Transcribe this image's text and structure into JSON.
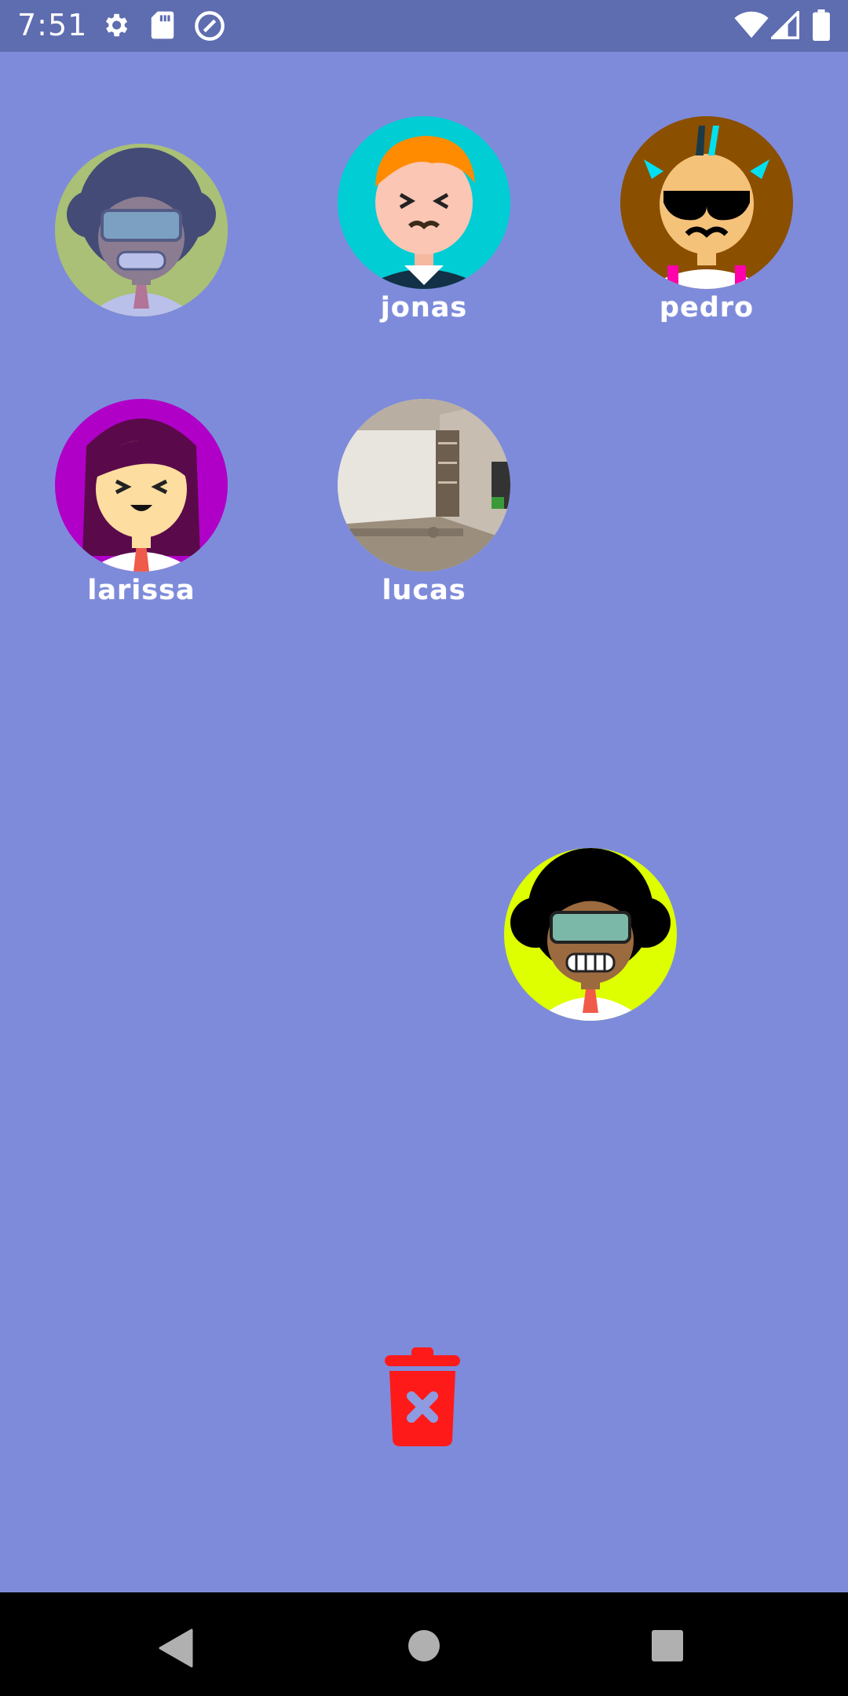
{
  "status_bar": {
    "time": "7:51",
    "left_icons": [
      "gear-icon",
      "sd-card-icon",
      "no-location-icon"
    ],
    "right_icons": [
      "wifi-icon",
      "cellular-signal-icon",
      "battery-icon"
    ]
  },
  "players": [
    {
      "name": "",
      "avatar": "afro-boy-goggles-faded"
    },
    {
      "name": "jonas",
      "avatar": "ginger-boy-mustache"
    },
    {
      "name": "pedro",
      "avatar": "mohawk-sunglasses-mustache"
    },
    {
      "name": "larissa",
      "avatar": "girl-purple-hair"
    },
    {
      "name": "lucas",
      "avatar": "room-photo"
    }
  ],
  "dragged_avatar": {
    "avatar": "afro-boy-goggles"
  },
  "trash": {
    "icon": "trash-delete-icon",
    "color": "#FF1A1A"
  },
  "colors": {
    "background": "#7E8BDA",
    "status_bar": "#5E6CB0",
    "nav_bar": "#000000"
  },
  "nav_bar": {
    "buttons": [
      "back-icon",
      "home-icon",
      "recents-icon"
    ]
  }
}
